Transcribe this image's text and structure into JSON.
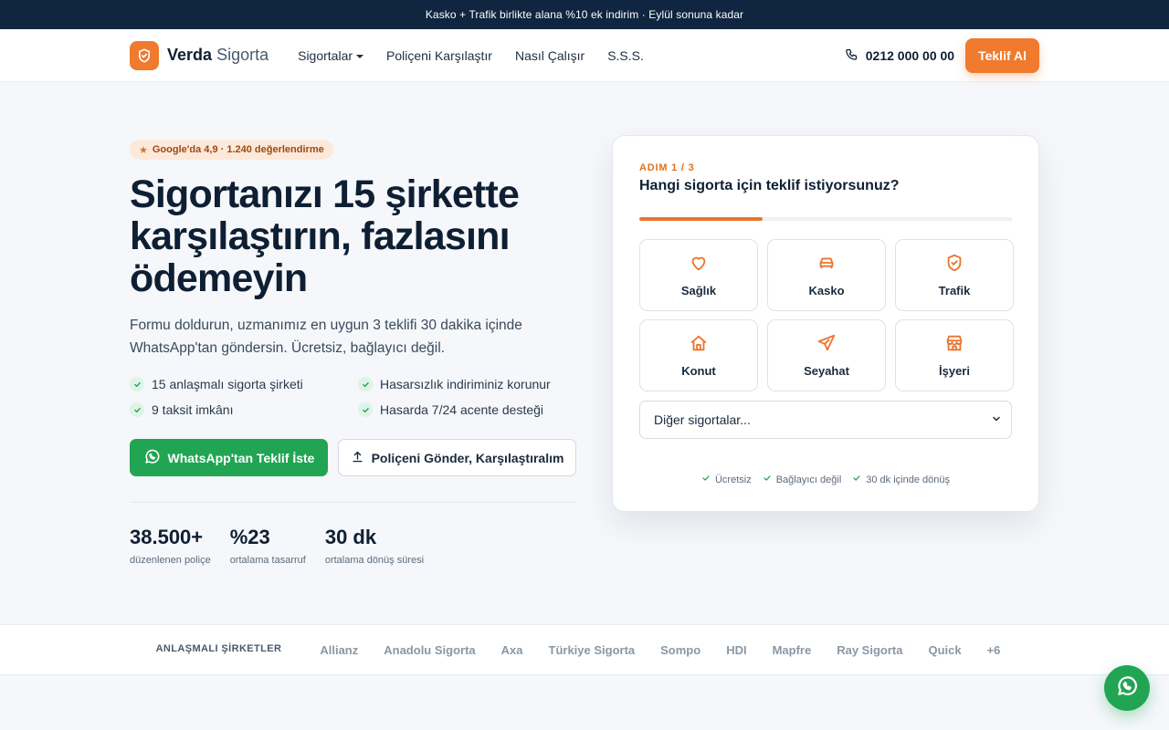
{
  "promo_bar": {
    "text": "Kasko + Trafik birlikte alana %10 ek indirim · Eylül sonuna kadar"
  },
  "header": {
    "logo": {
      "brand": "Verda",
      "suffix": "Sigorta"
    },
    "nav": [
      "Sigortalar",
      "Poliçeni Karşılaştır",
      "Nasıl Çalışır",
      "S.S.S."
    ],
    "phone": "0212 000 00 00",
    "cta": "Teklif Al"
  },
  "hero": {
    "rating_badge": "Google'da 4,9 · 1.240 değerlendirme",
    "title": "Sigortanızı 15 şirkette karşılaştırın, fazlasını ödemeyin",
    "subtitle": "Formu doldurun, uzmanımız en uygun 3 teklifi 30 dakika içinde WhatsApp'tan göndersin. Ücretsiz, bağlayıcı değil.",
    "features": [
      "15 anlaşmalı sigorta şirketi",
      "Hasarsızlık indiriminiz korunur",
      "9 taksit imkânı",
      "Hasarda 7/24 acente desteği"
    ],
    "primary_cta": "WhatsApp'tan Teklif İste",
    "secondary_cta": "Poliçeni Gönder, Karşılaştıralım",
    "stats": [
      {
        "value": "38.500+",
        "label": "düzenlenen poliçe"
      },
      {
        "value": "%23",
        "label": "ortalama tasarruf"
      },
      {
        "value": "30 dk",
        "label": "ortalama dönüş süresi"
      }
    ]
  },
  "quote_form": {
    "step": "ADIM 1 / 3",
    "question": "Hangi sigorta için teklif istiyorsunuz?",
    "progress": 0.33,
    "options": [
      {
        "label": "Sağlık",
        "icon": "heart-icon"
      },
      {
        "label": "Kasko",
        "icon": "car-icon"
      },
      {
        "label": "Trafik",
        "icon": "shield-check-icon"
      },
      {
        "label": "Konut",
        "icon": "home-icon"
      },
      {
        "label": "Seyahat",
        "icon": "plane-icon"
      },
      {
        "label": "İşyeri",
        "icon": "store-icon"
      }
    ],
    "other_select": "Diğer sigortalar...",
    "trust": [
      "Ücretsiz",
      "Bağlayıcı değil",
      "30 dk içinde dönüş"
    ]
  },
  "partners": {
    "title": "ANLAŞMALI ŞİRKETLER",
    "items": [
      "Allianz",
      "Anadolu Sigorta",
      "Axa",
      "Türkiye Sigorta",
      "Sompo",
      "HDI",
      "Mapfre",
      "Ray Sigorta",
      "Quick",
      "+6"
    ]
  },
  "colors": {
    "accent": "#f07a2e",
    "whatsapp": "#21a553",
    "navy": "#0f2540"
  }
}
